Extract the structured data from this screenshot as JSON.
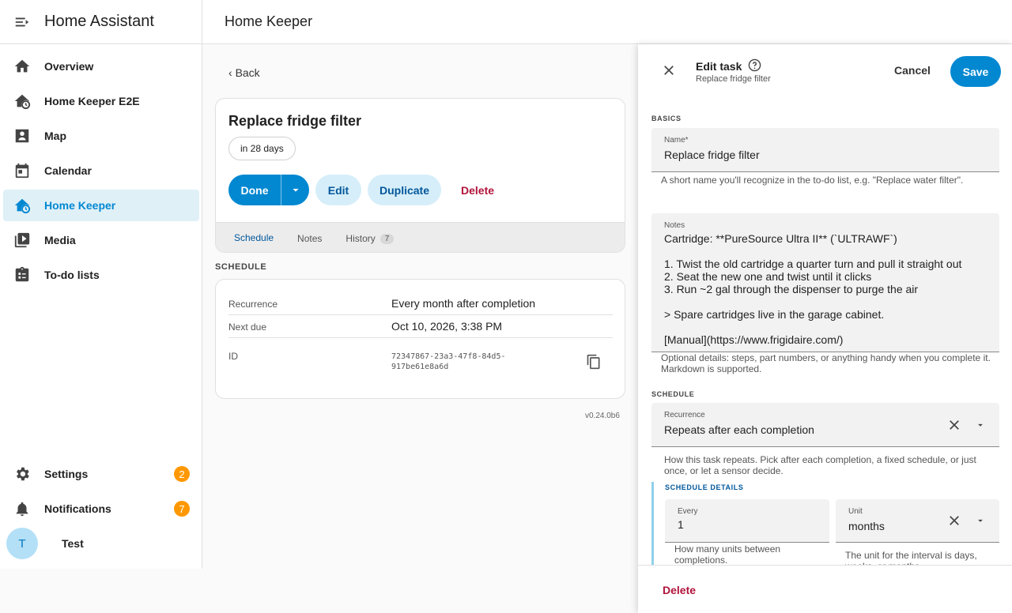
{
  "sidebar": {
    "title": "Home Assistant",
    "items": [
      {
        "label": "Overview",
        "icon": "home-icon"
      },
      {
        "label": "Home Keeper E2E",
        "icon": "home-clock-icon"
      },
      {
        "label": "Map",
        "icon": "map-icon"
      },
      {
        "label": "Calendar",
        "icon": "calendar-icon"
      },
      {
        "label": "Home Keeper",
        "icon": "home-clock-icon",
        "active": true
      },
      {
        "label": "Media",
        "icon": "media-icon"
      },
      {
        "label": "To-do lists",
        "icon": "clipboard-icon"
      }
    ],
    "settings": {
      "label": "Settings",
      "badge": "2"
    },
    "notifications": {
      "label": "Notifications",
      "badge": "7"
    },
    "user": {
      "initial": "T",
      "name": "Test"
    }
  },
  "topbar": {
    "title": "Home Keeper"
  },
  "back_label": "Back",
  "task": {
    "title": "Replace fridge filter",
    "due_chip": "in 28 days",
    "done_label": "Done",
    "edit_label": "Edit",
    "duplicate_label": "Duplicate",
    "delete_label": "Delete",
    "tabs": [
      {
        "label": "Schedule"
      },
      {
        "label": "Notes"
      },
      {
        "label": "History",
        "count": "7"
      }
    ]
  },
  "schedule": {
    "section_label": "SCHEDULE",
    "rows": [
      {
        "key": "Recurrence",
        "value": "Every month after completion"
      },
      {
        "key": "Next due",
        "value": "Oct 10, 2026, 3:38 PM"
      },
      {
        "key": "ID",
        "value": "72347867-23a3-47f8-84d5-\n917be61e8a6d"
      }
    ]
  },
  "version": "v0.24.0b6",
  "dialog": {
    "title": "Edit task",
    "subtitle": "Replace fridge filter",
    "cancel_label": "Cancel",
    "save_label": "Save",
    "basics_label": "BASICS",
    "name_label": "Name*",
    "name_value": "Replace fridge filter",
    "name_helper": "A short name you'll recognize in the to-do list, e.g. \"Replace water filter\".",
    "notes_label": "Notes",
    "notes_value": "Cartridge: **PureSource Ultra II** (`ULTRAWF`)\n\n1. Twist the old cartridge a quarter turn and pull it straight out\n2. Seat the new one and twist until it clicks\n3. Run ~2 gal through the dispenser to purge the air\n\n> Spare cartridges live in the garage cabinet.\n\n[Manual](https://www.frigidaire.com/)",
    "notes_helper": "Optional details: steps, part numbers, or anything handy when you complete it. Markdown is supported.",
    "schedule_label": "SCHEDULE",
    "recurrence_label": "Recurrence",
    "recurrence_value": "Repeats after each completion",
    "recurrence_helper": "How this task repeats. Pick after each completion, a fixed schedule, or just once, or let a sensor decide.",
    "details_label": "SCHEDULE DETAILS",
    "every_label": "Every",
    "every_value": "1",
    "every_helper": "How many units between completions.",
    "unit_label": "Unit",
    "unit_value": "months",
    "unit_helper": "The unit for the interval is days, weeks, or months.",
    "delete_label": "Delete"
  },
  "colors": {
    "accent": "#0288d1",
    "danger": "#b0143b",
    "badge": "#ff9800",
    "active_bg": "#dff0f7"
  }
}
